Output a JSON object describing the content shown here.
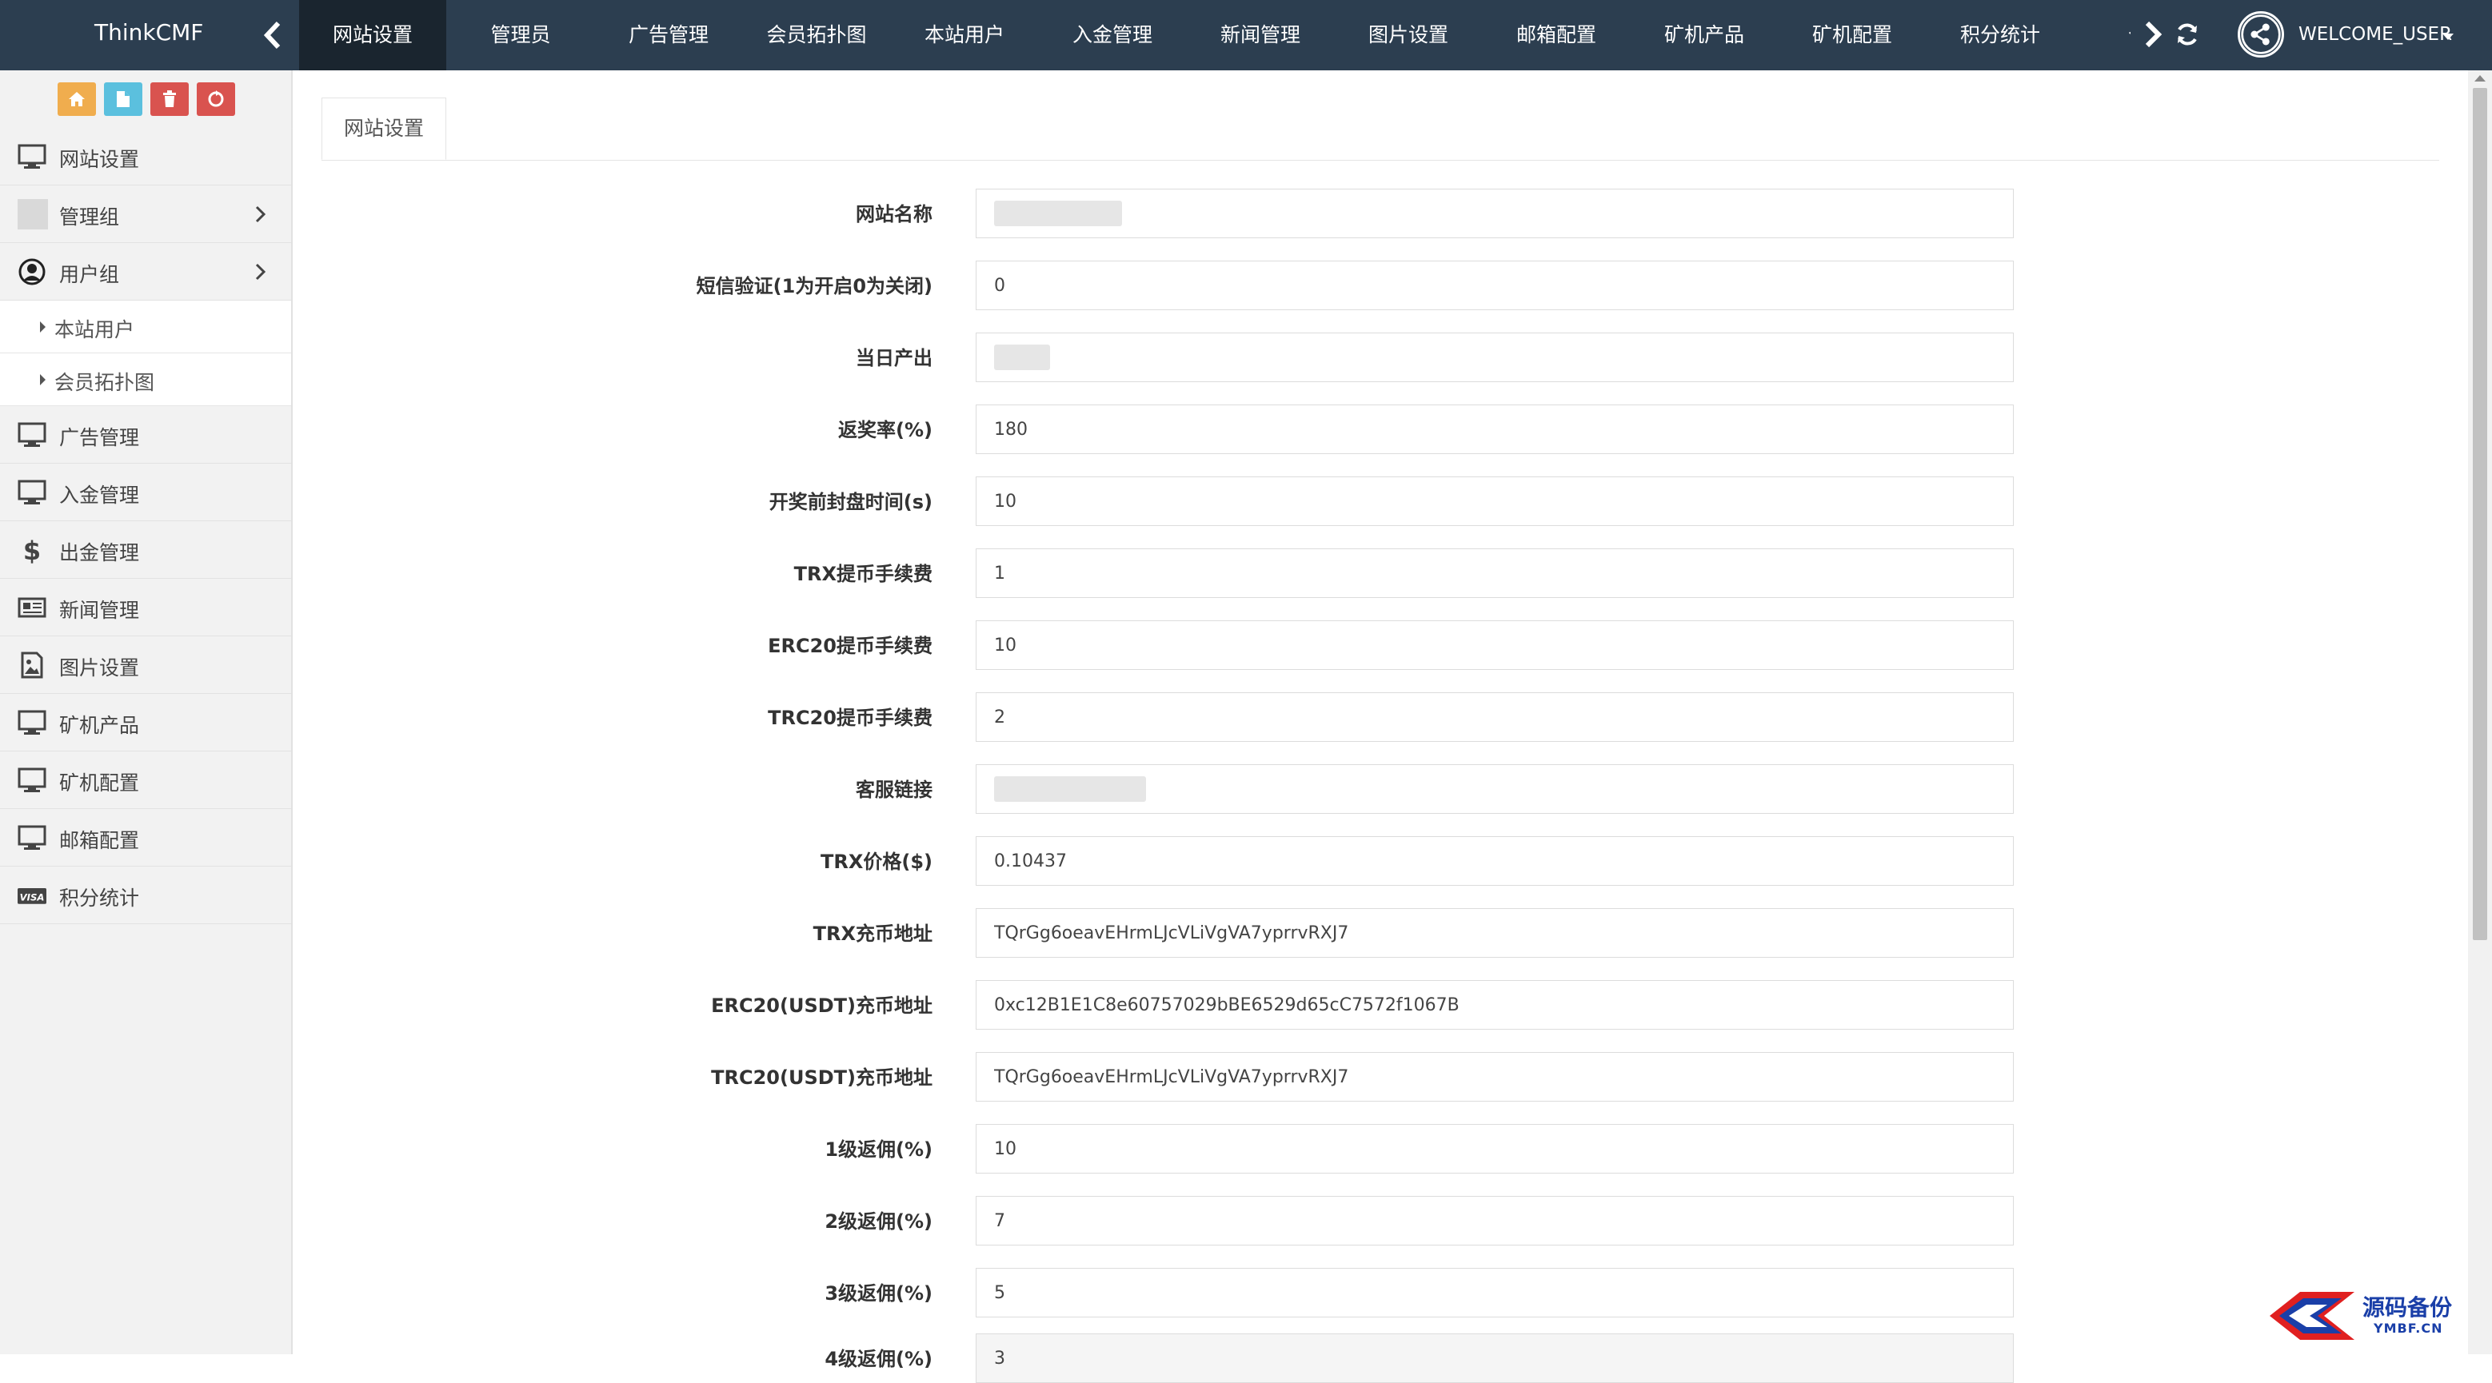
{
  "navbar": {
    "brand": "ThinkCMF",
    "items": [
      {
        "label": "网站设置"
      },
      {
        "label": "管理员"
      },
      {
        "label": "广告管理"
      },
      {
        "label": "会员拓扑图"
      },
      {
        "label": "本站用户"
      },
      {
        "label": "入金管理"
      },
      {
        "label": "新闻管理"
      },
      {
        "label": "图片设置"
      },
      {
        "label": "邮箱配置"
      },
      {
        "label": "矿机产品"
      },
      {
        "label": "矿机配置"
      },
      {
        "label": "积分统计"
      },
      {
        "label": "个人"
      }
    ],
    "active_index": 0,
    "user": "WELCOME_USER"
  },
  "shortcuts": [
    {
      "icon": "home-icon",
      "color": "#f0ad4e"
    },
    {
      "icon": "file-icon",
      "color": "#5bc0de"
    },
    {
      "icon": "trash-icon",
      "color": "#d9534f"
    },
    {
      "icon": "recycle-icon",
      "color": "#d9534f"
    }
  ],
  "sidebar": {
    "items": [
      {
        "label": "网站设置",
        "icon": "monitor-icon"
      },
      {
        "label": "管理组",
        "icon": "image-placeholder-icon"
      },
      {
        "label": "用户组",
        "icon": "user-circle-icon"
      },
      {
        "label": "广告管理",
        "icon": "monitor-icon"
      },
      {
        "label": "入金管理",
        "icon": "monitor-icon"
      },
      {
        "label": "出金管理",
        "icon": "dollar-icon"
      },
      {
        "label": "新闻管理",
        "icon": "newspaper-icon"
      },
      {
        "label": "图片设置",
        "icon": "picture-icon"
      },
      {
        "label": "矿机产品",
        "icon": "monitor-icon"
      },
      {
        "label": "矿机配置",
        "icon": "monitor-icon"
      },
      {
        "label": "邮箱配置",
        "icon": "monitor-icon"
      },
      {
        "label": "积分统计",
        "icon": "visa-icon"
      }
    ],
    "submenu": [
      {
        "label": "本站用户"
      },
      {
        "label": "会员拓扑图"
      }
    ]
  },
  "tab": {
    "label": "网站设置"
  },
  "form": {
    "fields": [
      {
        "label": "网站名称",
        "value": ""
      },
      {
        "label": "短信验证(1为开启0为关闭)",
        "value": "0"
      },
      {
        "label": "当日产出",
        "value": ""
      },
      {
        "label": "返奖率(%)",
        "value": "180"
      },
      {
        "label": "开奖前封盘时间(s)",
        "value": "10"
      },
      {
        "label": "TRX提币手续费",
        "value": "1"
      },
      {
        "label": "ERC20提币手续费",
        "value": "10"
      },
      {
        "label": "TRC20提币手续费",
        "value": "2"
      },
      {
        "label": "客服链接",
        "value": ""
      },
      {
        "label": "TRX价格($)",
        "value": "0.10437"
      },
      {
        "label": "TRX充币地址",
        "value": "TQrGg6oeavEHrmLJcVLiVgVA7yprrvRXJ7"
      },
      {
        "label": "ERC20(USDT)充币地址",
        "value": "0xc12B1E1C8e60757029bBE6529d65cC7572f1067B"
      },
      {
        "label": "TRC20(USDT)充币地址",
        "value": "TQrGg6oeavEHrmLJcVLiVgVA7yprrvRXJ7"
      },
      {
        "label": "1级返佣(%)",
        "value": "10"
      },
      {
        "label": "2级返佣(%)",
        "value": "7"
      },
      {
        "label": "3级返佣(%)",
        "value": "5"
      },
      {
        "label": "4级返佣(%)",
        "value": "3"
      }
    ]
  },
  "watermark": {
    "line1": "源码备份",
    "line2": "YMBF.CN"
  }
}
